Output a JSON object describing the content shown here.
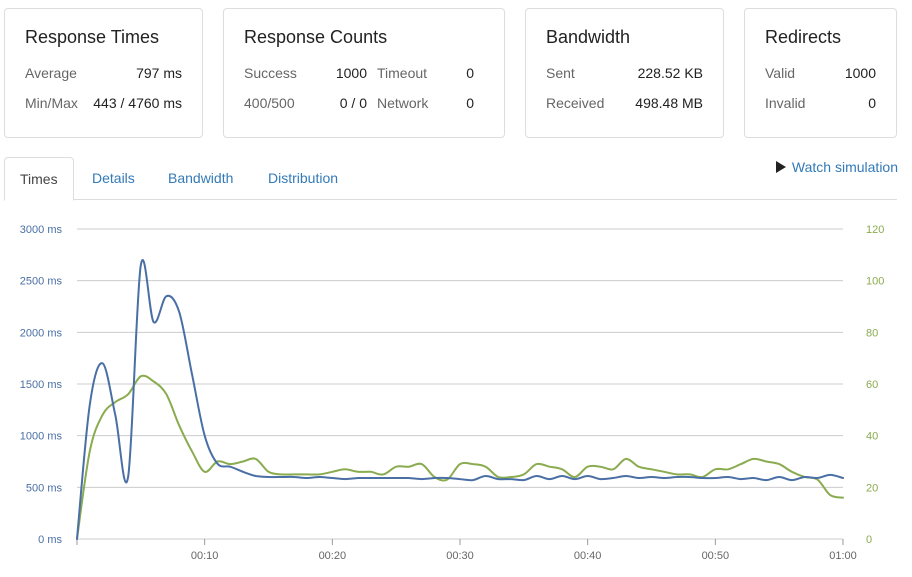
{
  "cards": {
    "response_times": {
      "title": "Response Times",
      "average_label": "Average",
      "average_value": "797 ms",
      "minmax_label": "Min/Max",
      "minmax_value": "443 / 4760 ms"
    },
    "response_counts": {
      "title": "Response Counts",
      "success_label": "Success",
      "success_value": "1000",
      "timeout_label": "Timeout",
      "timeout_value": "0",
      "http_error_label": "400/500",
      "http_error_value": "0 / 0",
      "network_label": "Network",
      "network_value": "0"
    },
    "bandwidth": {
      "title": "Bandwidth",
      "sent_label": "Sent",
      "sent_value": "228.52 KB",
      "received_label": "Received",
      "received_value": "498.48 MB"
    },
    "redirects": {
      "title": "Redirects",
      "valid_label": "Valid",
      "valid_value": "1000",
      "invalid_label": "Invalid",
      "invalid_value": "0"
    }
  },
  "tabs": [
    {
      "label": "Times",
      "active": true
    },
    {
      "label": "Details",
      "active": false
    },
    {
      "label": "Bandwidth",
      "active": false
    },
    {
      "label": "Distribution",
      "active": false
    }
  ],
  "watch_simulation": {
    "label": "Watch simulation",
    "icon": "play-icon"
  },
  "colors": {
    "response_time": "#4a6fa5",
    "concurrency": "#8aab4f",
    "grid": "#cccccc",
    "link": "#337ab7"
  },
  "chart_data": {
    "type": "line",
    "x_unit": "seconds",
    "xlim": [
      0,
      60
    ],
    "x_ticks": [
      10,
      20,
      30,
      40,
      50,
      60
    ],
    "x_tick_labels": [
      "00:10",
      "00:20",
      "00:30",
      "00:40",
      "00:50",
      "01:00"
    ],
    "y_left": {
      "range": [
        0,
        3000
      ],
      "ticks": [
        0,
        500,
        1000,
        1500,
        2000,
        2500,
        3000
      ],
      "tick_labels": [
        "0 ms",
        "500 ms",
        "1000 ms",
        "1500 ms",
        "2000 ms",
        "2500 ms",
        "3000 ms"
      ]
    },
    "y_right": {
      "range": [
        0,
        120
      ],
      "ticks": [
        0,
        20,
        40,
        60,
        80,
        100,
        120
      ],
      "tick_labels": [
        "0",
        "20",
        "40",
        "60",
        "80",
        "100",
        "120"
      ]
    },
    "grid": true,
    "legend": "none",
    "series": [
      {
        "axis": "left",
        "color": "#4a6fa5",
        "x": [
          0,
          1,
          2,
          3,
          4,
          5,
          6,
          7,
          8,
          9,
          10,
          11,
          12,
          13,
          14,
          15,
          16,
          17,
          18,
          19,
          20,
          21,
          22,
          23,
          24,
          25,
          26,
          27,
          28,
          29,
          30,
          31,
          32,
          33,
          34,
          35,
          36,
          37,
          38,
          39,
          40,
          41,
          42,
          43,
          44,
          45,
          46,
          47,
          48,
          49,
          50,
          51,
          52,
          53,
          54,
          55,
          56,
          57,
          58,
          59,
          60
        ],
        "values": [
          0,
          1300,
          1700,
          1200,
          600,
          2650,
          2100,
          2350,
          2200,
          1600,
          1000,
          730,
          700,
          650,
          610,
          600,
          600,
          600,
          590,
          600,
          590,
          580,
          590,
          590,
          590,
          590,
          590,
          580,
          590,
          590,
          580,
          570,
          610,
          580,
          580,
          570,
          610,
          580,
          610,
          580,
          610,
          580,
          590,
          610,
          590,
          600,
          590,
          600,
          600,
          590,
          590,
          600,
          580,
          590,
          570,
          600,
          570,
          600,
          590,
          620,
          590
        ]
      },
      {
        "axis": "right",
        "color": "#8aab4f",
        "x": [
          0,
          1,
          2,
          3,
          4,
          5,
          6,
          7,
          8,
          9,
          10,
          11,
          12,
          13,
          14,
          15,
          16,
          17,
          18,
          19,
          20,
          21,
          22,
          23,
          24,
          25,
          26,
          27,
          28,
          29,
          30,
          31,
          32,
          33,
          34,
          35,
          36,
          37,
          38,
          39,
          40,
          41,
          42,
          43,
          44,
          45,
          46,
          47,
          48,
          49,
          50,
          51,
          52,
          53,
          54,
          55,
          56,
          57,
          58,
          59,
          60
        ],
        "values": [
          0,
          34,
          48,
          53,
          56,
          63,
          61,
          56,
          44,
          34,
          26,
          30,
          29,
          30,
          31,
          26,
          25,
          25,
          25,
          25,
          26,
          27,
          26,
          26,
          25,
          28,
          28,
          29,
          24,
          23,
          29,
          29,
          28,
          24,
          24,
          25,
          29,
          28,
          27,
          24,
          28,
          28,
          27,
          31,
          28,
          27,
          26,
          25,
          25,
          24,
          27,
          27,
          29,
          31,
          30,
          29,
          26,
          24,
          23,
          17,
          16
        ]
      }
    ]
  }
}
